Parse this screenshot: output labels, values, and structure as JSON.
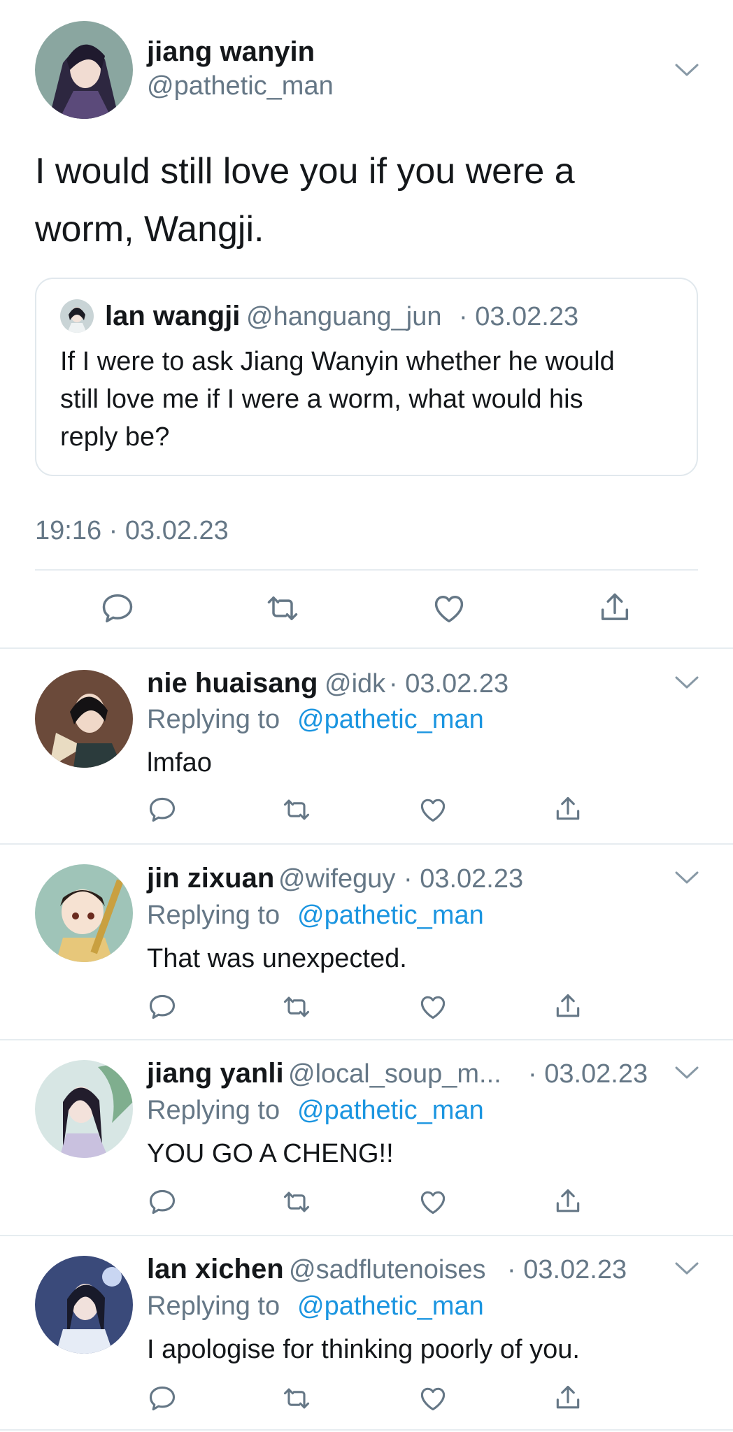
{
  "main_tweet": {
    "display_name": "jiang wanyin",
    "handle": "@pathetic_man",
    "text_line1": "I would still love you if you were a",
    "text_line2": "worm, Wangji.",
    "timestamp": "19:16 · 03.02.23",
    "quoted": {
      "display_name": "lan wangji",
      "handle": "@hanguang_jun",
      "date": "· 03.02.23",
      "line1": "If I were to ask Jiang Wanyin whether he would",
      "line2": "still love me if I were a worm, what would his",
      "line3": "reply be?"
    }
  },
  "replies": [
    {
      "display_name": "nie huaisang",
      "handle": "@idk",
      "date": "· 03.02.23",
      "replying_prefix": "Replying to",
      "replying_to": "@pathetic_man",
      "text": "lmfao"
    },
    {
      "display_name": "jin zixuan",
      "handle": "@wifeguy",
      "date": "· 03.02.23",
      "replying_prefix": "Replying to",
      "replying_to": "@pathetic_man",
      "text": "That was unexpected."
    },
    {
      "display_name": "jiang yanli",
      "handle": "@local_soup_m...",
      "date": "· 03.02.23",
      "replying_prefix": "Replying to",
      "replying_to": "@pathetic_man",
      "text": "YOU GO A CHENG!!"
    },
    {
      "display_name": "lan xichen",
      "handle": "@sadflutenoises",
      "date": "· 03.02.23",
      "replying_prefix": "Replying to",
      "replying_to": "@pathetic_man",
      "text": "I apologise for thinking poorly of you."
    }
  ],
  "icons": [
    "reply-icon",
    "retweet-icon",
    "like-icon",
    "share-icon",
    "chevron-down-icon"
  ],
  "colors": {
    "link": "#1b95e0",
    "secondary_text": "#657786",
    "divider": "#e6ecf0",
    "icon": "#657786"
  }
}
